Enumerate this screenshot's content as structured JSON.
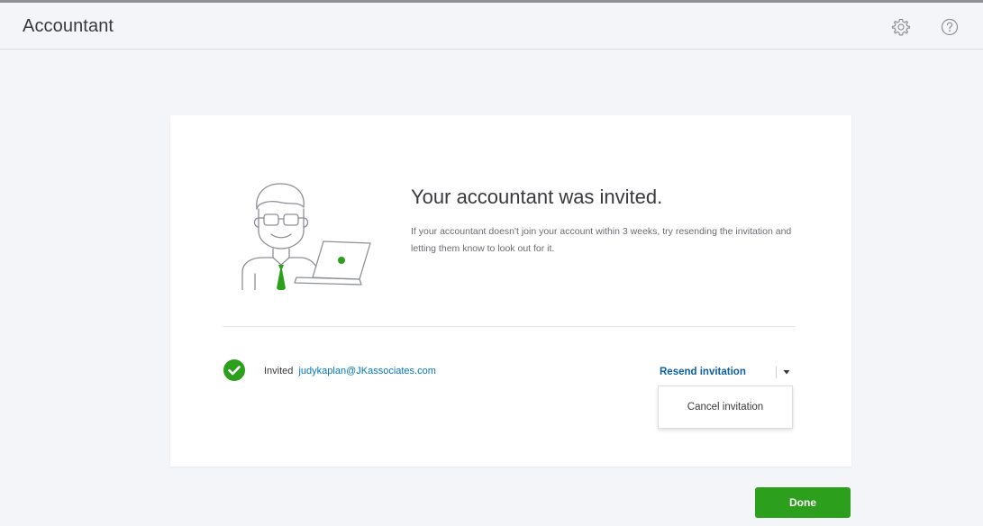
{
  "header": {
    "title": "Accountant",
    "gear_icon": "gear-icon",
    "help_icon": "help-icon"
  },
  "card": {
    "illustration_icon": "accountant-illustration",
    "heading": "Your accountant was invited.",
    "description": "If your accountant doesn't join your account within 3 weeks, try resending the invitation and letting them know to look out for it."
  },
  "invitation": {
    "status_icon": "check-circle-icon",
    "invited_label": "Invited",
    "email": "judykaplan@JKassociates.com",
    "resend_label": "Resend invitation",
    "menu": {
      "items": [
        {
          "label": "Cancel invitation"
        }
      ]
    }
  },
  "footer": {
    "done_label": "Done"
  },
  "colors": {
    "accent_green": "#2ca01c",
    "link_blue": "#0077c5",
    "resend_blue": "#0d5fa6",
    "page_bg": "#f4f5f8"
  }
}
